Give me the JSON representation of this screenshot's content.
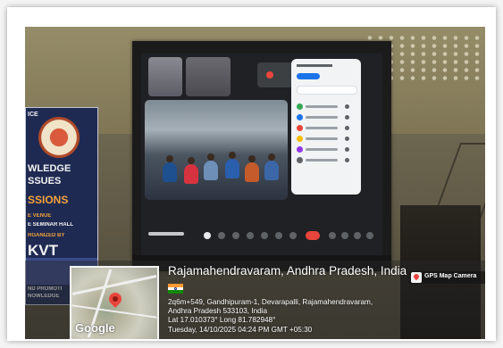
{
  "banner": {
    "lines": [
      "ICE",
      "WLEDGE",
      "SSUES",
      "SSIONS",
      "E VENUE",
      "E SEMINAR HALL",
      "RGANIZED BY",
      "KVT",
      "ND PROMOTI",
      "NOWLEDGE"
    ]
  },
  "gps_badge": {
    "app_name": "GPS Map Camera"
  },
  "map": {
    "provider": "Google"
  },
  "location": {
    "title": "Rajamahendravaram, Andhra Pradesh, India",
    "address_line1": "2q6m+549, Gandhipuram-1, Devarapalli, Rajamahendravaram,",
    "address_line2": "Andhra Pradesh 533103, India",
    "coordinates": "Lat 17.010373° Long 81.782948°",
    "timestamp": "Tuesday, 14/10/2025 04:24 PM GMT +05:30"
  },
  "colors": {
    "map_pin": "#e8453c",
    "flag_saffron": "#ff9933",
    "flag_green": "#138808"
  }
}
